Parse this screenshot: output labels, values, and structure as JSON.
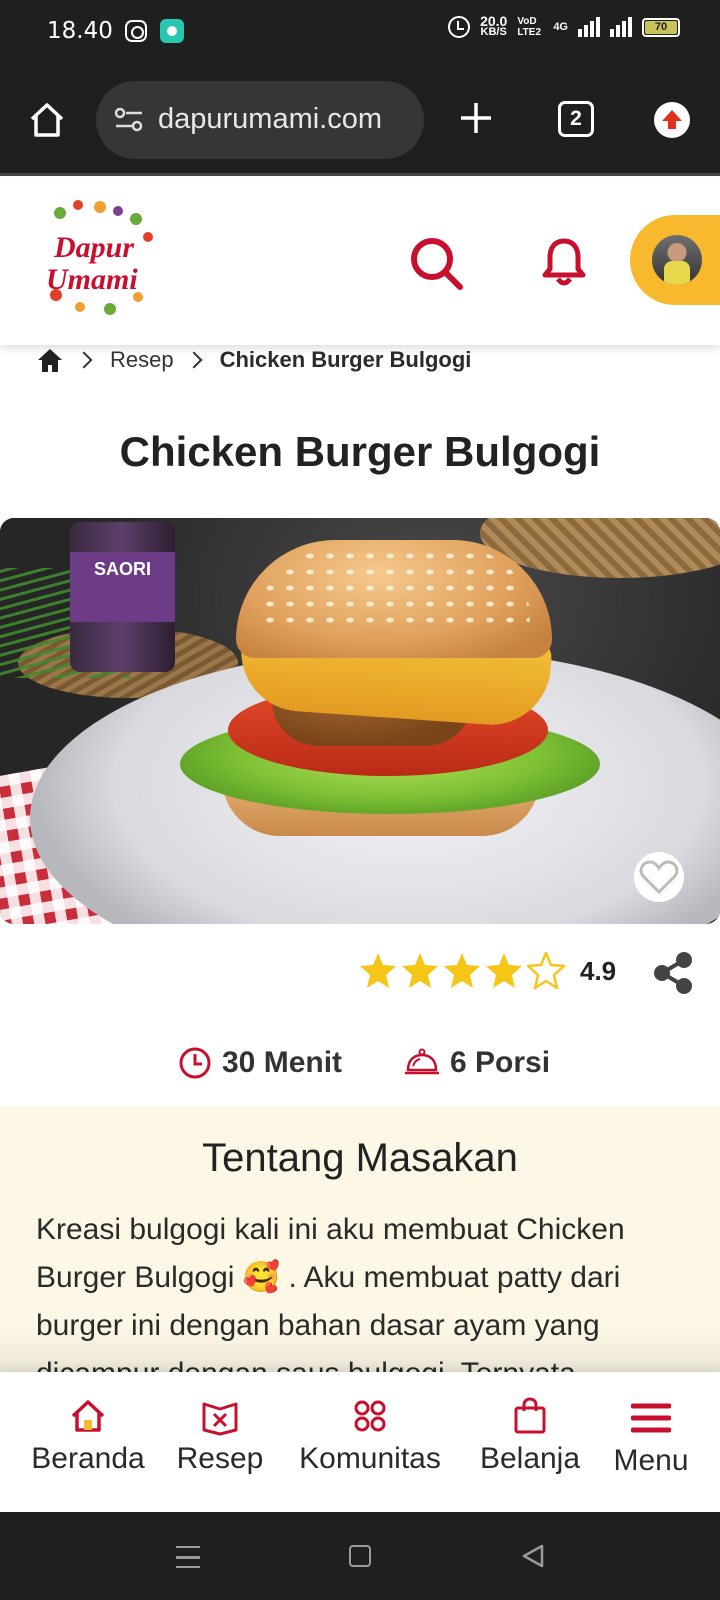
{
  "status_bar": {
    "time": "18.40",
    "net_speed_value": "20.0",
    "net_speed_unit": "KB/S",
    "volte": "VoD LTE2",
    "network": "4G",
    "battery": "70"
  },
  "browser": {
    "url": "dapurumami.com",
    "tab_count": "2"
  },
  "site": {
    "logo_text_line1": "Dapur",
    "logo_text_line2": "Umami"
  },
  "breadcrumb": {
    "items": [
      "Resep",
      "Chicken Burger Bulgogi"
    ]
  },
  "recipe": {
    "title": "Chicken Burger Bulgogi",
    "image_jar_label": "SAORI",
    "rating_value": "4.9",
    "rating_stars": 4,
    "rating_max": 5,
    "time": "30 Menit",
    "servings": "6 Porsi"
  },
  "about": {
    "heading": "Tentang Masakan",
    "text": "Kreasi bulgogi kali ini aku membuat Chicken Burger Bulgogi 🥰 . Aku membuat patty dari burger ini dengan bahan dasar ayam yang dicampur dengan saus bulgogi. Ternyata"
  },
  "bottom_nav": {
    "beranda": "Beranda",
    "resep": "Resep",
    "komunitas": "Komunitas",
    "belanja": "Belanja",
    "menu": "Menu"
  },
  "colors": {
    "brand_red": "#c8102e",
    "accent_yellow": "#f9b92f",
    "star_yellow": "#f5c518",
    "about_bg": "#fdf8e6"
  }
}
